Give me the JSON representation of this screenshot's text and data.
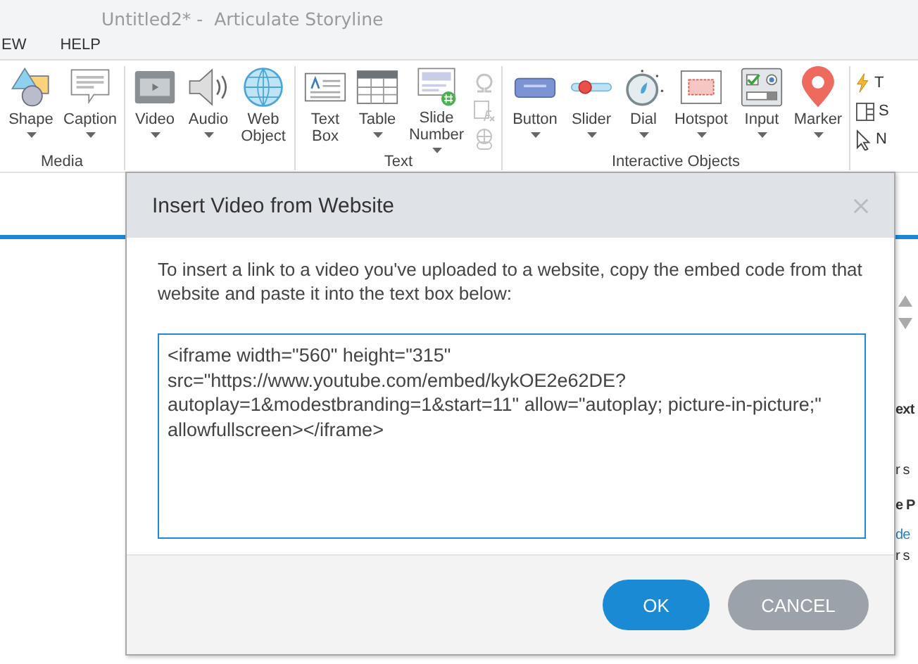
{
  "window": {
    "title": "Untitled2* -  Articulate Storyline"
  },
  "menu": [
    {
      "label": "EW"
    },
    {
      "label": "HELP"
    }
  ],
  "ribbon": {
    "groups": [
      {
        "label": "Media",
        "tools": [
          {
            "label": "Shape",
            "dropdown": true
          },
          {
            "label": "Caption",
            "dropdown": true
          }
        ]
      },
      {
        "tools": [
          {
            "label": "Video",
            "dropdown": true
          },
          {
            "label": "Audio",
            "dropdown": true
          },
          {
            "label": "Web Object",
            "dropdown": false
          }
        ]
      },
      {
        "label": "Text",
        "tools": [
          {
            "label": "Text Box",
            "dropdown": false
          },
          {
            "label": "Table",
            "dropdown": true
          },
          {
            "label": "Slide Number",
            "dropdown": true
          }
        ],
        "small_tools": [
          {
            "disabled": true
          },
          {
            "disabled": true
          },
          {
            "disabled": true
          }
        ]
      },
      {
        "label": "Interactive Objects",
        "tools": [
          {
            "label": "Button",
            "dropdown": true
          },
          {
            "label": "Slider",
            "dropdown": true
          },
          {
            "label": "Dial",
            "dropdown": true
          },
          {
            "label": "Hotspot",
            "dropdown": true
          },
          {
            "label": "Input",
            "dropdown": true
          },
          {
            "label": "Marker",
            "dropdown": true
          }
        ]
      }
    ],
    "side_tools": [
      {
        "label": "T"
      },
      {
        "label": "S"
      },
      {
        "label": "N"
      }
    ]
  },
  "side_panel": {
    "items": [
      {
        "label": "ext",
        "kind": "heading"
      },
      {
        "label": "r s",
        "kind": "text"
      },
      {
        "label": "e P",
        "kind": "heading"
      },
      {
        "label": "de",
        "kind": "link"
      },
      {
        "label": "r s",
        "kind": "text"
      }
    ]
  },
  "dialog": {
    "title": "Insert Video from Website",
    "instructions": "To insert a link to a video you've uploaded to a website, copy the embed code from that website and paste it into the text box below:",
    "embed_code": "<iframe width=\"560\" height=\"315\" src=\"https://www.youtube.com/embed/kykOE2e62DE?autoplay=1&modestbranding=1&start=11\" allow=\"autoplay; picture-in-picture;\" allowfullscreen></iframe>",
    "buttons": [
      {
        "label": "OK",
        "kind": "primary"
      },
      {
        "label": "CANCEL",
        "kind": "secondary"
      }
    ]
  }
}
